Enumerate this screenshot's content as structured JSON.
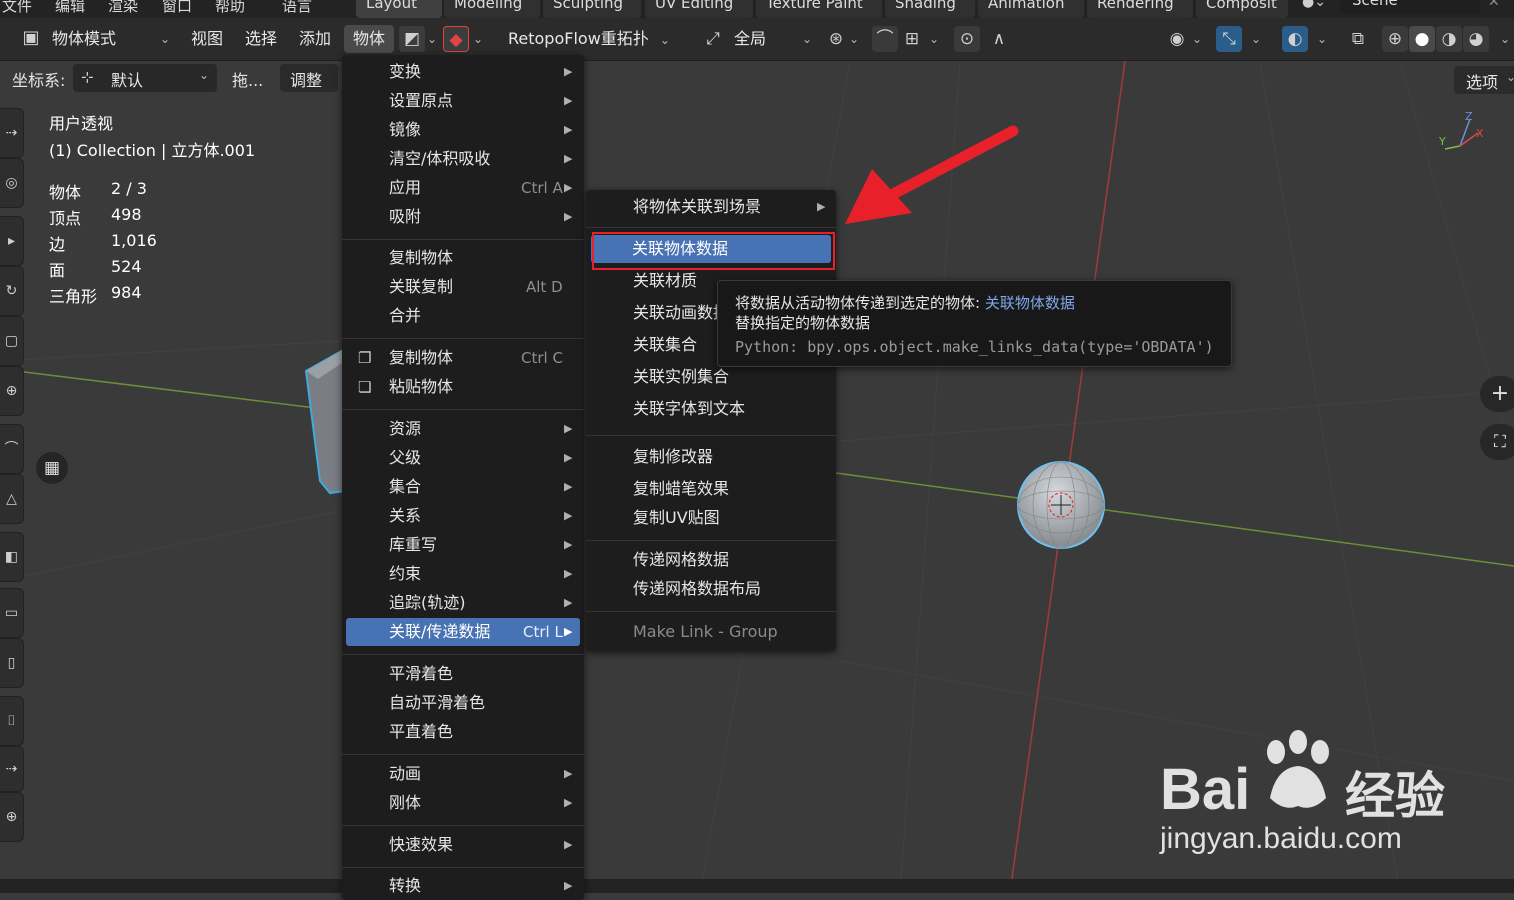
{
  "top_menu": {
    "items": [
      "文件",
      "编辑",
      "渲染",
      "窗口",
      "帮助",
      "语言"
    ],
    "workspace_tabs": [
      "Layout",
      "Modeling",
      "Sculpting",
      "UV Editing",
      "Texture Paint",
      "Shading",
      "Animation",
      "Rendering",
      "Composit"
    ],
    "scene_label": "Scene"
  },
  "header": {
    "mode": "物体模式",
    "menus": [
      "视图",
      "选择",
      "添加",
      "物体"
    ],
    "addon": "RetopoFlow重拓扑",
    "transform_pivot": "全局",
    "options_label": "选项"
  },
  "tool_settings": {
    "coord_label": "坐标系:",
    "coord_value": "默认",
    "drag_label": "拖...",
    "adjust_label": "调整"
  },
  "viewport": {
    "view_name": "用户透视",
    "collection_line": "(1) Collection | 立方体.001",
    "stats": [
      {
        "label": "物体",
        "value": "2 / 3"
      },
      {
        "label": "顶点",
        "value": "498"
      },
      {
        "label": "边",
        "value": "1,016"
      },
      {
        "label": "面",
        "value": "524"
      },
      {
        "label": "三角形",
        "value": "984"
      }
    ],
    "axis_labels": [
      "X",
      "Y",
      "Z"
    ]
  },
  "object_menu": {
    "items": [
      {
        "label": "变换",
        "shortcut": "",
        "submenu": true
      },
      {
        "label": "设置原点",
        "shortcut": "",
        "submenu": true
      },
      {
        "label": "镜像",
        "shortcut": "",
        "submenu": true
      },
      {
        "label": "清空/体积吸收",
        "shortcut": "",
        "submenu": true
      },
      {
        "label": "应用",
        "shortcut": "Ctrl A",
        "submenu": true
      },
      {
        "label": "吸附",
        "shortcut": "",
        "submenu": true
      },
      {
        "label": "复制物体",
        "shortcut": "",
        "submenu": false
      },
      {
        "label": "关联复制",
        "shortcut": "Alt D",
        "submenu": false
      },
      {
        "label": "合并",
        "shortcut": "",
        "submenu": false
      },
      {
        "label": "复制物体",
        "shortcut": "Ctrl C",
        "submenu": false
      },
      {
        "label": "粘贴物体",
        "shortcut": "",
        "submenu": false
      },
      {
        "label": "资源",
        "shortcut": "",
        "submenu": true
      },
      {
        "label": "父级",
        "shortcut": "",
        "submenu": true
      },
      {
        "label": "集合",
        "shortcut": "",
        "submenu": true
      },
      {
        "label": "关系",
        "shortcut": "",
        "submenu": true
      },
      {
        "label": "库重写",
        "shortcut": "",
        "submenu": true
      },
      {
        "label": "约束",
        "shortcut": "",
        "submenu": true
      },
      {
        "label": "追踪(轨迹)",
        "shortcut": "",
        "submenu": true
      },
      {
        "label": "关联/传递数据",
        "shortcut": "Ctrl L",
        "submenu": true
      },
      {
        "label": "平滑着色",
        "shortcut": "",
        "submenu": false
      },
      {
        "label": "自动平滑着色",
        "shortcut": "",
        "submenu": false
      },
      {
        "label": "平直着色",
        "shortcut": "",
        "submenu": false
      },
      {
        "label": "动画",
        "shortcut": "",
        "submenu": true
      },
      {
        "label": "刚体",
        "shortcut": "",
        "submenu": true
      },
      {
        "label": "快速效果",
        "shortcut": "",
        "submenu": true
      },
      {
        "label": "转换",
        "shortcut": "",
        "submenu": true
      }
    ]
  },
  "link_menu": {
    "items": [
      {
        "label": "将物体关联到场景",
        "submenu": true
      },
      {
        "label": "关联物体数据",
        "submenu": false
      },
      {
        "label": "关联材质",
        "submenu": false
      },
      {
        "label": "关联动画数据",
        "submenu": false
      },
      {
        "label": "关联集合",
        "submenu": false
      },
      {
        "label": "关联实例集合",
        "submenu": false
      },
      {
        "label": "关联字体到文本",
        "submenu": false
      },
      {
        "label": "复制修改器",
        "submenu": false
      },
      {
        "label": "复制蜡笔效果",
        "submenu": false
      },
      {
        "label": "复制UV贴图",
        "submenu": false
      },
      {
        "label": "传递网格数据",
        "submenu": false
      },
      {
        "label": "传递网格数据布局",
        "submenu": false
      },
      {
        "label": "Make Link - Group",
        "submenu": false
      }
    ]
  },
  "tooltip": {
    "description": "将数据从活动物体传递到选定的物体:",
    "operator": "关联物体数据",
    "detail": "替换指定的物体数据",
    "python": "Python: bpy.ops.object.make_links_data(type='OBDATA')"
  },
  "watermark": {
    "brand": "Bai",
    "brand_cn": "经验",
    "url": "jingyan.baidu.com"
  },
  "colors": {
    "menu_bg": "#1d1d1d",
    "highlight": "#4772b3",
    "annotation_red": "#e8202a",
    "tooltip_link": "#7fa7e8"
  }
}
